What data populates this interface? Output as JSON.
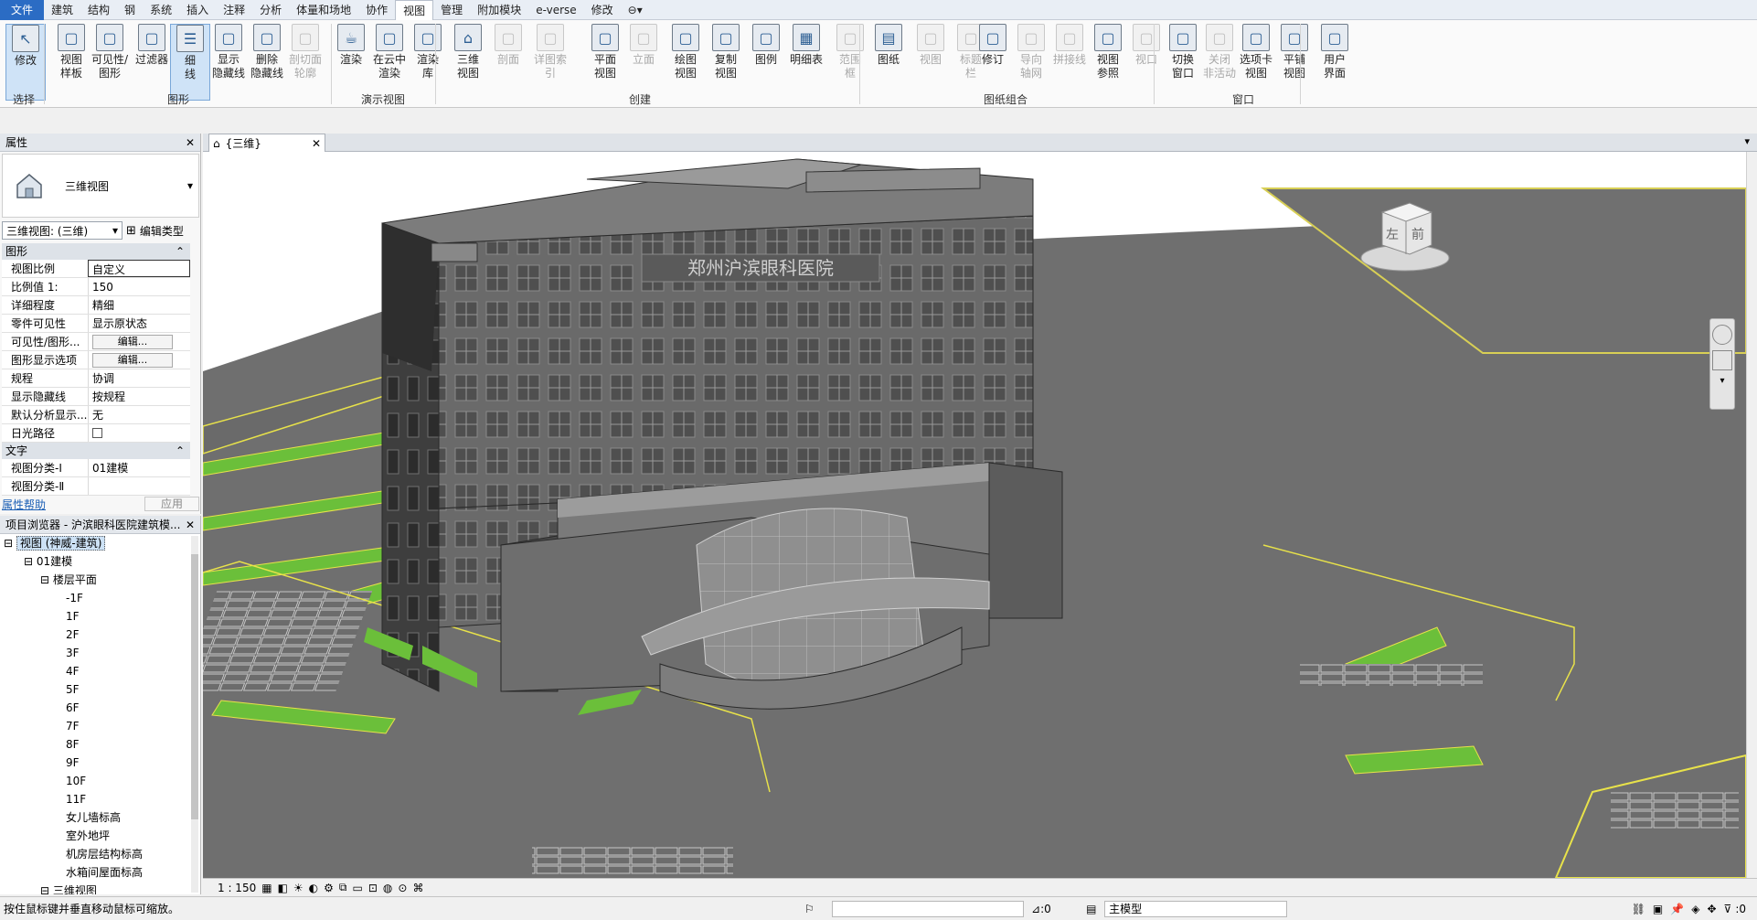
{
  "menu": [
    "文件",
    "建筑",
    "结构",
    "钢",
    "系统",
    "插入",
    "注释",
    "分析",
    "体量和场地",
    "协作",
    "视图",
    "管理",
    "附加模块",
    "e-verse",
    "修改"
  ],
  "ribbon": {
    "buttons": [
      {
        "l1": "修改",
        "l2": "",
        "icon": "cursor-icon",
        "state": "sel"
      },
      {
        "l1": "视图",
        "l2": "样板",
        "icon": "view-template-icon",
        "state": ""
      },
      {
        "l1": "可见性/",
        "l2": "图形",
        "icon": "visibility-graphics-icon",
        "state": ""
      },
      {
        "l1": "过滤器",
        "l2": "",
        "icon": "filter-icon",
        "state": ""
      },
      {
        "l1": "细",
        "l2": "线",
        "icon": "thin-lines-icon",
        "state": "sel"
      },
      {
        "l1": "显示",
        "l2": "隐藏线",
        "icon": "show-hidden-lines-icon",
        "state": ""
      },
      {
        "l1": "删除",
        "l2": "隐藏线",
        "icon": "remove-hidden-lines-icon",
        "state": ""
      },
      {
        "l1": "剖切面",
        "l2": "轮廓",
        "icon": "cut-profile-icon",
        "state": "dis"
      },
      {
        "l1": "渲染",
        "l2": "",
        "icon": "render-icon",
        "state": ""
      },
      {
        "l1": "在云中",
        "l2": "渲染",
        "icon": "cloud-render-icon",
        "state": ""
      },
      {
        "l1": "渲染",
        "l2": "库",
        "icon": "render-gallery-icon",
        "state": ""
      },
      {
        "l1": "三维",
        "l2": "视图",
        "icon": "3d-view-icon",
        "state": ""
      },
      {
        "l1": "剖面",
        "l2": "",
        "icon": "section-icon",
        "state": "dis"
      },
      {
        "l1": "详图索引",
        "l2": "",
        "icon": "callout-icon",
        "state": "dis"
      },
      {
        "l1": "平面",
        "l2": "视图",
        "icon": "plan-view-icon",
        "state": ""
      },
      {
        "l1": "立面",
        "l2": "",
        "icon": "elevation-icon",
        "state": "dis"
      },
      {
        "l1": "绘图",
        "l2": "视图",
        "icon": "drafting-view-icon",
        "state": ""
      },
      {
        "l1": "复制",
        "l2": "视图",
        "icon": "duplicate-view-icon",
        "state": ""
      },
      {
        "l1": "图例",
        "l2": "",
        "icon": "legend-icon",
        "state": ""
      },
      {
        "l1": "明细表",
        "l2": "",
        "icon": "schedule-icon",
        "state": ""
      },
      {
        "l1": "范围",
        "l2": "框",
        "icon": "scope-box-icon",
        "state": "dis"
      },
      {
        "l1": "图纸",
        "l2": "",
        "icon": "sheet-icon",
        "state": ""
      },
      {
        "l1": "视图",
        "l2": "",
        "icon": "place-view-icon",
        "state": "dis"
      },
      {
        "l1": "标题",
        "l2": "栏",
        "icon": "title-block-icon",
        "state": "dis"
      },
      {
        "l1": "修订",
        "l2": "",
        "icon": "revisions-icon",
        "state": ""
      },
      {
        "l1": "导向",
        "l2": "轴网",
        "icon": "guide-grid-icon",
        "state": "dis"
      },
      {
        "l1": "拼接线",
        "l2": "",
        "icon": "matchline-icon",
        "state": "dis"
      },
      {
        "l1": "视图",
        "l2": "参照",
        "icon": "view-reference-icon",
        "state": ""
      },
      {
        "l1": "视口",
        "l2": "",
        "icon": "viewport-icon",
        "state": "dis"
      },
      {
        "l1": "切换",
        "l2": "窗口",
        "icon": "switch-windows-icon",
        "state": ""
      },
      {
        "l1": "关闭",
        "l2": "非活动",
        "icon": "close-inactive-icon",
        "state": "dis"
      },
      {
        "l1": "选项卡",
        "l2": "视图",
        "icon": "tab-views-icon",
        "state": ""
      },
      {
        "l1": "平铺",
        "l2": "视图",
        "icon": "tile-views-icon",
        "state": ""
      },
      {
        "l1": "用户",
        "l2": "界面",
        "icon": "user-interface-icon",
        "state": ""
      }
    ],
    "groups": [
      "选择",
      "图形",
      "演示视图",
      "创建",
      "图纸组合",
      "窗口"
    ]
  },
  "properties": {
    "title": "属性",
    "type_name": "三维视图",
    "selector": "三维视图: (三维)",
    "edit_type": "编辑类型",
    "cat_graphics": "图形",
    "rows": [
      {
        "k": "视图比例",
        "v": "自定义"
      },
      {
        "k": "比例值 1:",
        "v": "150"
      },
      {
        "k": "详细程度",
        "v": "精细"
      },
      {
        "k": "零件可见性",
        "v": "显示原状态"
      },
      {
        "k": "可见性/图形...",
        "v": "编辑..."
      },
      {
        "k": "图形显示选项",
        "v": "编辑..."
      },
      {
        "k": "规程",
        "v": "协调"
      },
      {
        "k": "显示隐藏线",
        "v": "按规程"
      },
      {
        "k": "默认分析显示...",
        "v": "无"
      },
      {
        "k": "日光路径",
        "v": ""
      }
    ],
    "cat_text": "文字",
    "rows2": [
      {
        "k": "视图分类-Ⅰ",
        "v": "01建模"
      },
      {
        "k": "视图分类-Ⅱ",
        "v": ""
      }
    ],
    "help": "属性帮助",
    "apply": "应用"
  },
  "browser": {
    "title": "项目浏览器 - 沪滨眼科医院建筑模...",
    "root": "视图 (神威-建筑)",
    "group": "01建模",
    "sub": "楼层平面",
    "levels": [
      "-1F",
      "1F",
      "2F",
      "3F",
      "4F",
      "5F",
      "6F",
      "7F",
      "8F",
      "9F",
      "10F",
      "11F",
      "女儿墙标高",
      "室外地坪",
      "机房层结构标高",
      "水箱间屋面标高"
    ],
    "sub2": "三维视图"
  },
  "view": {
    "tab": "{三维}",
    "viewcube_left": "左",
    "viewcube_front": "前",
    "building_sign": "郑州沪滨眼科医院"
  },
  "viewbar": {
    "scale": "1 : 150"
  },
  "status": {
    "hint": "按住鼠标键并垂直移动鼠标可缩放。",
    "sel_count": ":0",
    "model": "主模型",
    "filter_count": ":0"
  }
}
